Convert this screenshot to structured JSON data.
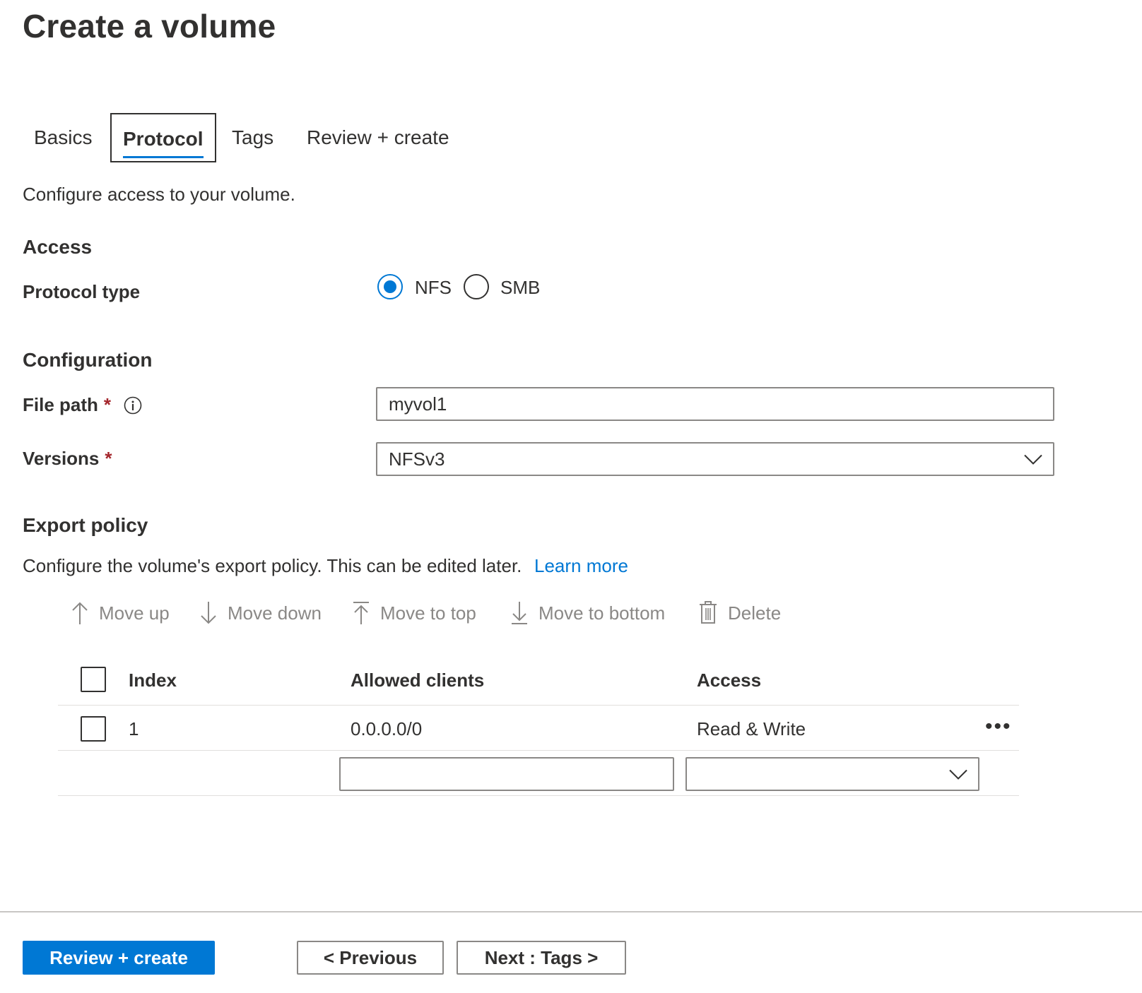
{
  "page": {
    "title": "Create a volume"
  },
  "tabs": [
    {
      "label": "Basics",
      "active": false
    },
    {
      "label": "Protocol",
      "active": true
    },
    {
      "label": "Tags",
      "active": false
    },
    {
      "label": "Review + create",
      "active": false
    }
  ],
  "intro": "Configure access to your volume.",
  "access": {
    "heading": "Access",
    "protocol_label": "Protocol type",
    "options": [
      {
        "label": "NFS",
        "selected": true
      },
      {
        "label": "SMB",
        "selected": false
      }
    ]
  },
  "configuration": {
    "heading": "Configuration",
    "file_path_label": "File path",
    "file_path_value": "myvol1",
    "versions_label": "Versions",
    "versions_value": "NFSv3",
    "required_mark": "*",
    "info_icon": "info-icon"
  },
  "export_policy": {
    "heading": "Export policy",
    "description": "Configure the volume's export policy. This can be edited later.",
    "learn_more": "Learn more",
    "toolbar": {
      "move_up": "Move up",
      "move_down": "Move down",
      "move_to_top": "Move to top",
      "move_to_bottom": "Move to bottom",
      "delete": "Delete"
    },
    "columns": {
      "index": "Index",
      "allowed_clients": "Allowed clients",
      "access": "Access"
    },
    "rows": [
      {
        "index": "1",
        "allowed_clients": "0.0.0.0/0",
        "access": "Read & Write",
        "more": "•••"
      }
    ],
    "new_row": {
      "allowed_clients_value": "",
      "access_value": ""
    }
  },
  "footer": {
    "review_create": "Review + create",
    "previous": "< Previous",
    "next": "Next : Tags >"
  },
  "colors": {
    "accent": "#0078d4",
    "text": "#323130",
    "disabled_text": "#8a8886",
    "required": "#a4262c",
    "border": "#8a8886"
  }
}
